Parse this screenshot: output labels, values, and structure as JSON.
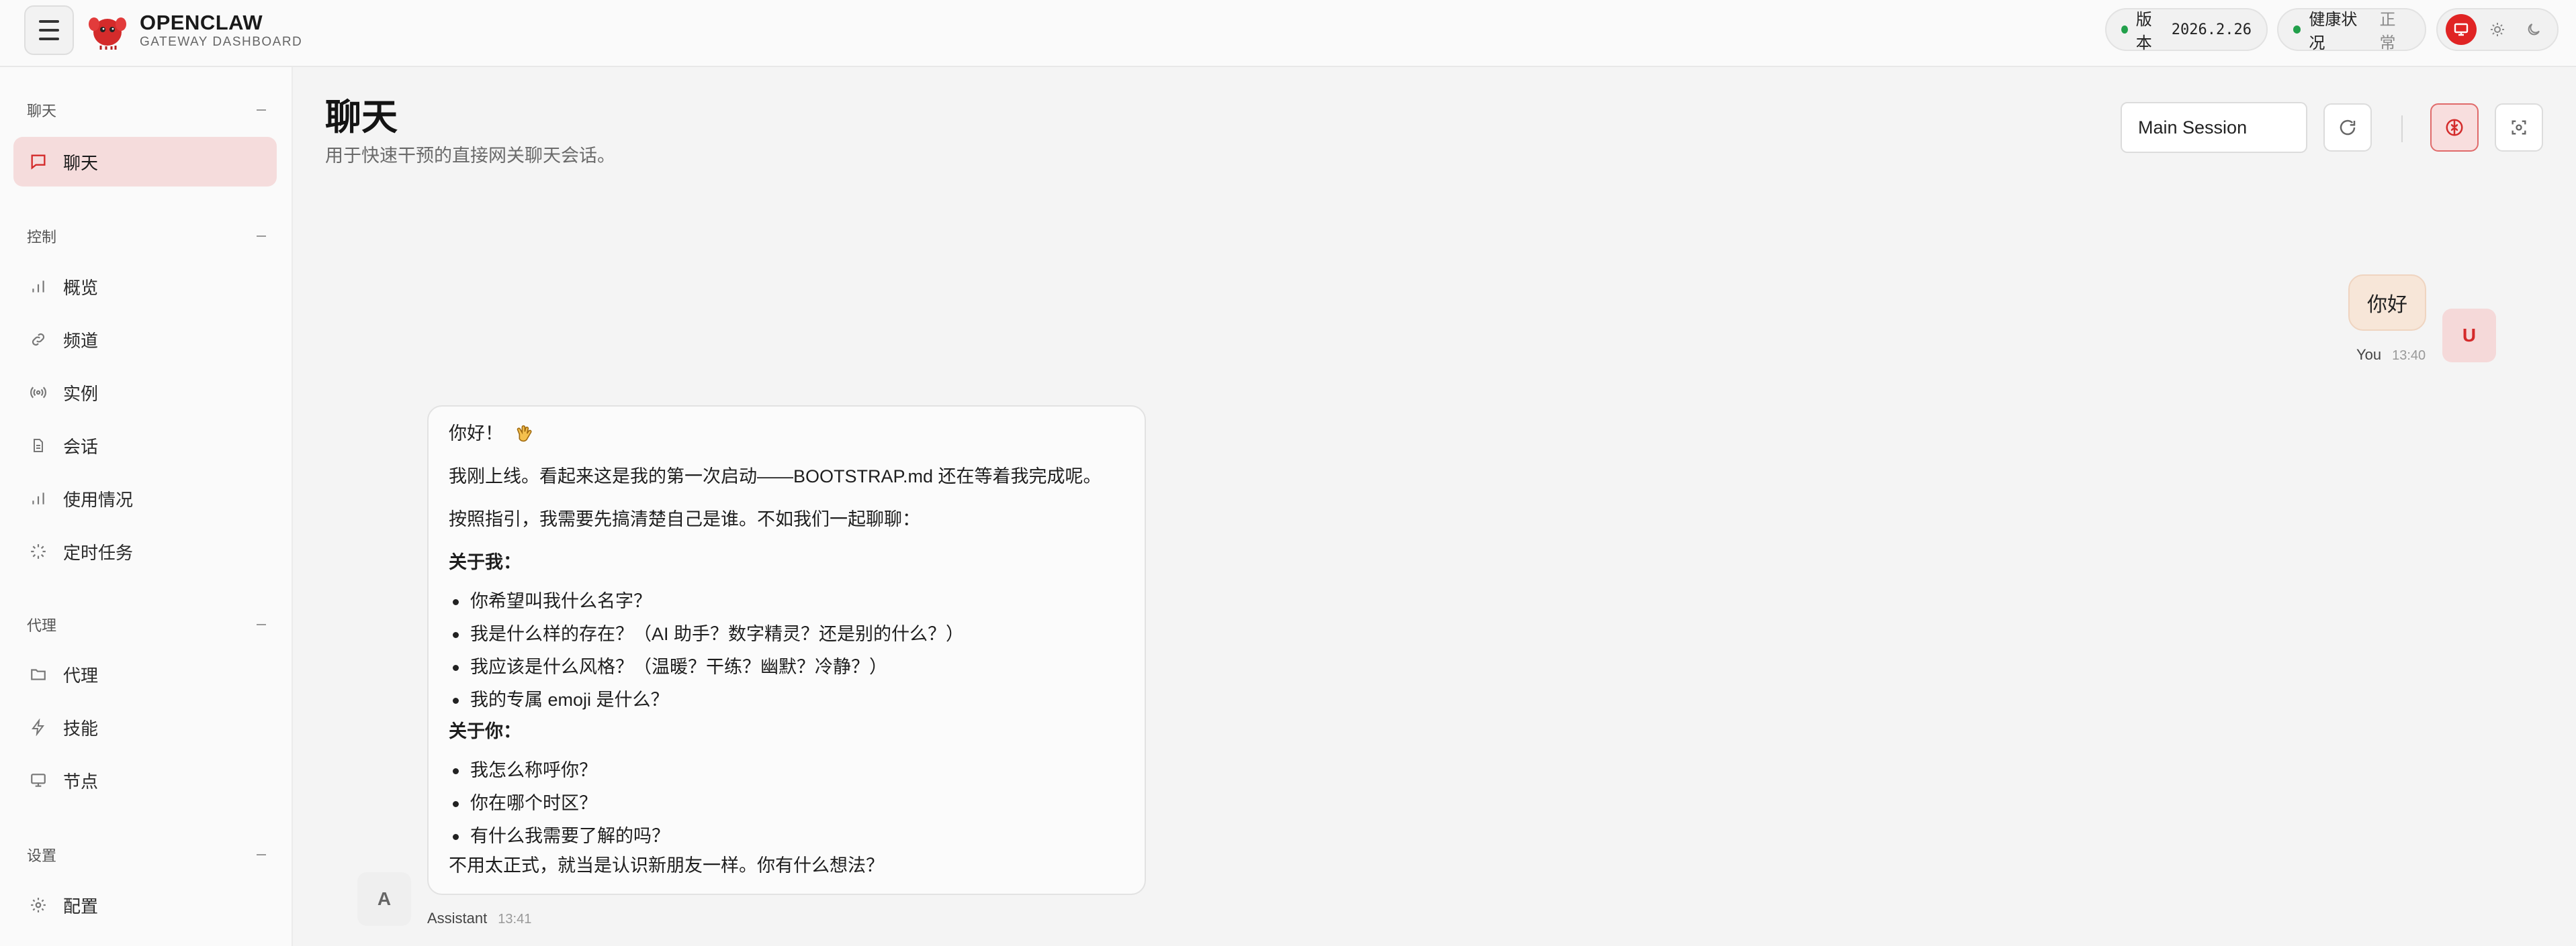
{
  "brand": {
    "title": "OPENCLAW",
    "subtitle": "GATEWAY DASHBOARD"
  },
  "status": {
    "version_label": "版本",
    "version_value": "2026.2.26",
    "health_label": "健康状况",
    "health_value": "正常"
  },
  "sidebar": {
    "sections": [
      {
        "title": "聊天",
        "items": [
          {
            "label": "聊天",
            "icon": "message-icon",
            "active": true
          }
        ]
      },
      {
        "title": "控制",
        "items": [
          {
            "label": "概览",
            "icon": "bar-chart-icon"
          },
          {
            "label": "频道",
            "icon": "link-icon"
          },
          {
            "label": "实例",
            "icon": "broadcast-icon"
          },
          {
            "label": "会话",
            "icon": "document-icon"
          },
          {
            "label": "使用情况",
            "icon": "bar-chart-icon"
          },
          {
            "label": "定时任务",
            "icon": "loader-icon"
          }
        ]
      },
      {
        "title": "代理",
        "items": [
          {
            "label": "代理",
            "icon": "folder-icon"
          },
          {
            "label": "技能",
            "icon": "zap-icon"
          },
          {
            "label": "节点",
            "icon": "monitor-icon"
          }
        ]
      },
      {
        "title": "设置",
        "items": [
          {
            "label": "配置",
            "icon": "gear-icon"
          }
        ]
      }
    ]
  },
  "page": {
    "title": "聊天",
    "subtitle": "用于快速干预的直接网关聊天会话。"
  },
  "controls": {
    "session": "Main Session"
  },
  "chat": {
    "user": {
      "avatar": "U",
      "text": "你好",
      "author": "You",
      "time": "13:40"
    },
    "assistant": {
      "avatar": "A",
      "author": "Assistant",
      "time": "13:41",
      "greeting": "你好！",
      "line1": "我刚上线。看起来这是我的第一次启动——BOOTSTRAP.md 还在等着我完成呢。",
      "line2": "按照指引，我需要先搞清楚自己是谁。不如我们一起聊聊：",
      "about_me_title": "关于我：",
      "about_me": [
        "你希望叫我什么名字？",
        "我是什么样的存在？（AI 助手？数字精灵？还是别的什么？）",
        "我应该是什么风格？（温暖？干练？幽默？冷静？）",
        "我的专属 emoji 是什么？"
      ],
      "about_you_title": "关于你：",
      "about_you": [
        "我怎么称呼你？",
        "你在哪个时区？",
        "有什么我需要了解的吗？"
      ],
      "closing": "不用太正式，就当是认识新朋友一样。你有什么想法？"
    }
  },
  "colors": {
    "accent": "#e02424",
    "active_nav_bg": "#f5dcdc",
    "user_bubble": "#f7e6d8"
  }
}
